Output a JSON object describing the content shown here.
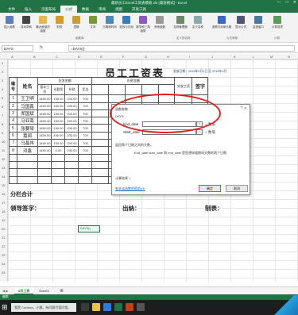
{
  "window": {
    "title": "最新员工Excel工资表模板.xls [兼容模式] - Excel",
    "controls": [
      "—",
      "□",
      "✕"
    ]
  },
  "ribbon": {
    "tabs": [
      "文件",
      "插入",
      "页面布局",
      "公式",
      "数据",
      "审阅",
      "视图",
      "开发工具"
    ],
    "active_tab": "公式",
    "buttons": [
      "插入函数",
      "自动求和",
      "最近使用的函数",
      "财务",
      "逻辑",
      "文本",
      "日期和时间",
      "查找与引用",
      "数学和三角函数",
      "其他函数",
      "名称管理器",
      "定义名称",
      "追踪引用单元格",
      "显示公式",
      "监视窗口",
      "计算选项"
    ],
    "groups": [
      "函数库",
      "定义的名称",
      "公式审核",
      "计算"
    ]
  },
  "formula_bar": {
    "name_box": "DAYS",
    "fx": "fx",
    "formula": "=DAYS()"
  },
  "columns": [
    "A",
    "B",
    "C",
    "D",
    "E",
    "F",
    "G",
    "H",
    "I",
    "J",
    "K",
    "L",
    "M",
    "N"
  ],
  "rows": [
    "1",
    "2",
    "3",
    "4",
    "5",
    "6",
    "7",
    "8",
    "9",
    "10",
    "11",
    "12",
    "13",
    "14",
    "15",
    "16",
    "17",
    "18",
    "19",
    "20",
    "21",
    "22",
    "23",
    "24",
    "25"
  ],
  "sheet": {
    "title": "员工工资表",
    "date_line": "发放日期：2019年2月1日  至  2019年1月",
    "headers": {
      "num": "编号",
      "name": "姓名",
      "group1": "应发金额",
      "group2": "扣款金额",
      "c1": "基本工资",
      "c2": "业勤奖",
      "c3": "补助",
      "c4": "奖金",
      "c5": "实发工资",
      "c6": "签字"
    },
    "employees": [
      {
        "num": "1",
        "name": "王卫明",
        "vals": [
          "1450.00",
          "150.00",
          "200.00",
          "700"
        ]
      },
      {
        "num": "2",
        "name": "马国鑫",
        "vals": [
          "1450.00",
          "150.00",
          "200.00",
          "700"
        ]
      },
      {
        "num": "3",
        "name": "郑国斌",
        "vals": [
          "1450.00",
          "150.00",
          "200.00",
          "700"
        ]
      },
      {
        "num": "4",
        "name": "马亚南",
        "vals": [
          "1450.00",
          "150.00",
          "200.00",
          "700"
        ]
      },
      {
        "num": "5",
        "name": "张要琴",
        "vals": [
          "1450.00",
          "150.00",
          "200.00",
          "700"
        ]
      },
      {
        "num": "6",
        "name": "嘉闻",
        "vals": [
          "1450.00",
          "150.00",
          "200.00",
          "700"
        ]
      },
      {
        "num": "7",
        "name": "马晶伟",
        "vals": [
          "1450.00",
          "150.00",
          "200.00",
          "700"
        ]
      },
      {
        "num": "8",
        "name": "邓鑫",
        "vals": [
          "1450.00",
          "0.00",
          "200.00",
          "700"
        ]
      }
    ],
    "subtotal": "分栏合计",
    "signatures": {
      "leader": "领导签字：",
      "cashier": "出纳：",
      "maker": "制表："
    },
    "active_cell": "DAYS()"
  },
  "dialog": {
    "title": "函数参数",
    "close": "?   ✕",
    "group": "DAYS",
    "args": [
      {
        "label": "End_date",
        "value": "",
        "eq": "= 数值"
      },
      {
        "label": "Start_date",
        "value": "",
        "eq": "= 数值"
      }
    ],
    "ref": "↑",
    "description": "返回两个日期之间的天数。",
    "arg_description": "End_date  start_date 和 end_date 是您想知道期间天数的两个日期",
    "result": "计算结果 =",
    "help_link": "有关该函数的帮助(H)",
    "ok": "确定",
    "cancel": "取消"
  },
  "sheet_tabs": {
    "nav": "◀ ▶",
    "tabs": [
      "5月工资",
      "Sheet3"
    ],
    "active": "5月工资",
    "add": "⊕"
  },
  "status": "编辑",
  "taskbar": {
    "start": "⊞",
    "search_placeholder": "我是 Cortana，小娜。有问题尽管问我。"
  },
  "colors": {
    "excel_green": "#217346",
    "highlight_red": "#e02020",
    "date_blue": "#1a3d8f"
  }
}
